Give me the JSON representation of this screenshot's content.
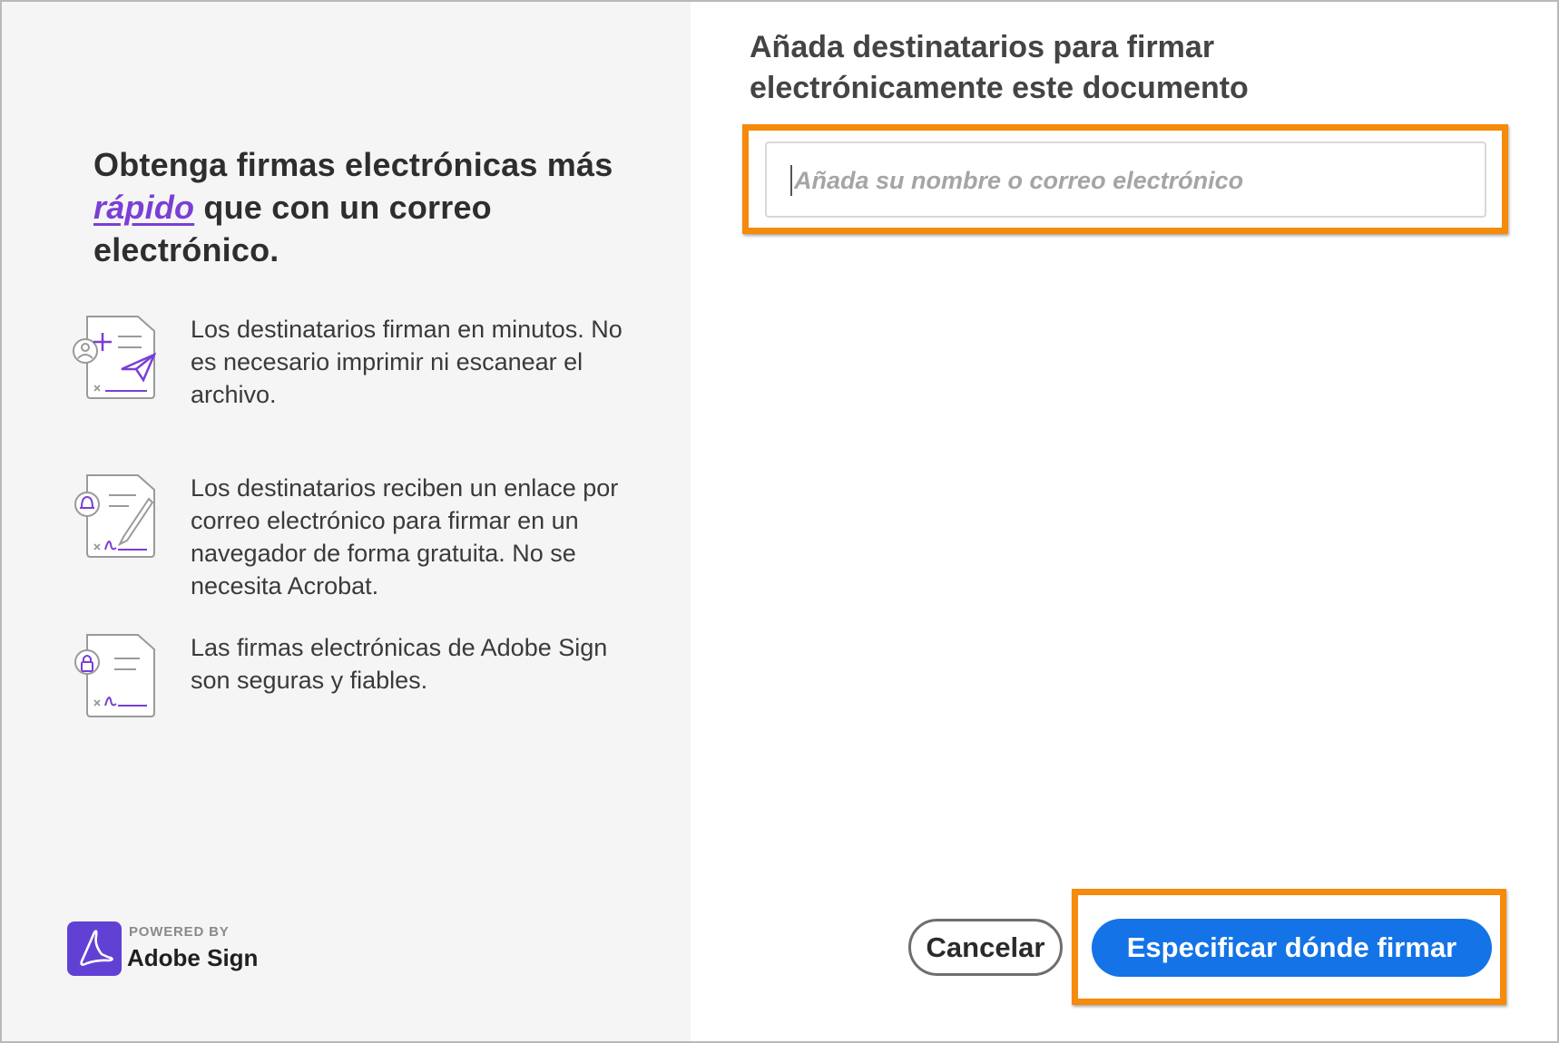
{
  "left": {
    "headline_part1": "Obtenga firmas electrónicas más",
    "headline_accent": "rápido",
    "headline_part2": "que con un correo electrónico.",
    "features": [
      {
        "icon": "send-document-icon",
        "text": "Los destinatarios firman en minutos. No es necesario imprimir ni escanear el archivo."
      },
      {
        "icon": "notify-sign-icon",
        "text": "Los destinatarios reciben un enlace por correo electrónico para firmar en un navegador de forma gratuita. No se necesita Acrobat."
      },
      {
        "icon": "secure-sign-icon",
        "text": "Las firmas electrónicas de Adobe Sign son seguras y fiables."
      }
    ],
    "powered_by": "POWERED BY",
    "brand": "Adobe Sign"
  },
  "right": {
    "title": "Añada destinatarios para firmar electrónicamente este documento",
    "recipient_placeholder": "Añada su nombre o correo electrónico",
    "cancel_label": "Cancelar",
    "primary_label": "Especificar dónde firmar"
  },
  "colors": {
    "accent_purple": "#7a3fd4",
    "primary_blue": "#1473e6",
    "highlight_orange": "#f58a0b",
    "brand_purple": "#6141d4"
  }
}
